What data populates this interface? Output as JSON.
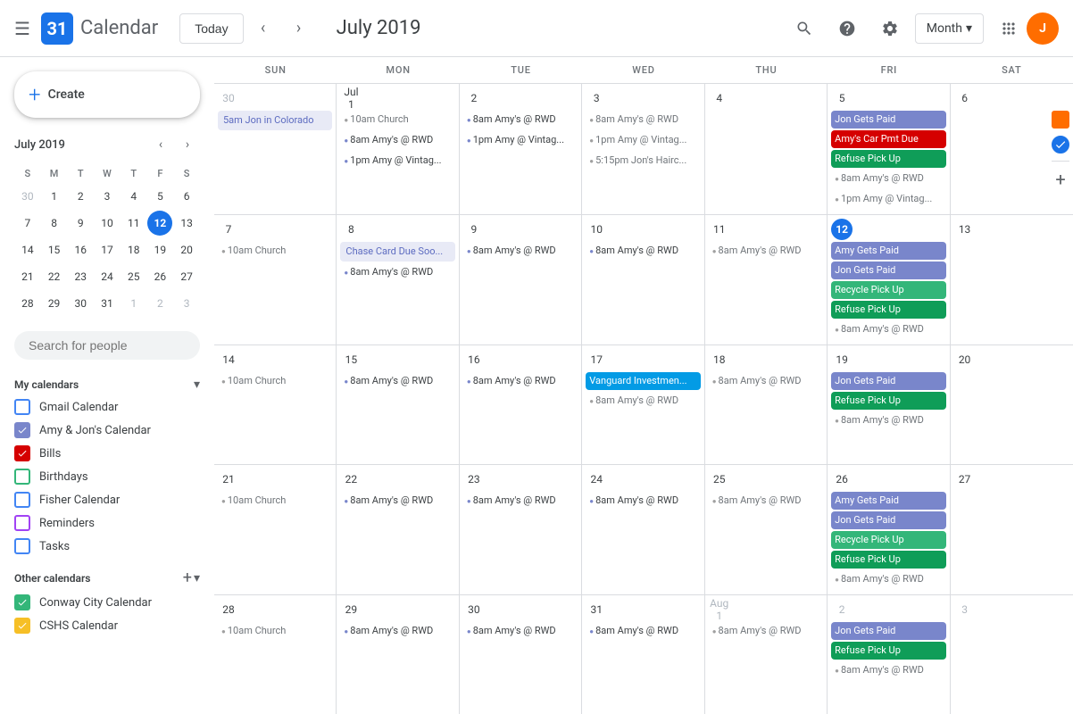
{
  "topbar": {
    "menu_label": "☰",
    "logo_num": "31",
    "app_name": "Calendar",
    "today_label": "Today",
    "nav_prev": "‹",
    "nav_next": "›",
    "title": "July 2019",
    "search_icon": "🔍",
    "help_icon": "?",
    "settings_icon": "⚙",
    "view_label": "Month",
    "apps_icon": "⋮⋮⋮",
    "avatar_initials": "J"
  },
  "sidebar": {
    "create_label": "Create",
    "mini_cal": {
      "title": "July 2019",
      "dows": [
        "S",
        "M",
        "T",
        "W",
        "T",
        "F",
        "S"
      ],
      "weeks": [
        [
          {
            "d": "30",
            "other": true
          },
          {
            "d": "1"
          },
          {
            "d": "2"
          },
          {
            "d": "3"
          },
          {
            "d": "4"
          },
          {
            "d": "5"
          },
          {
            "d": "6"
          }
        ],
        [
          {
            "d": "7"
          },
          {
            "d": "8"
          },
          {
            "d": "9"
          },
          {
            "d": "10"
          },
          {
            "d": "11"
          },
          {
            "d": "12",
            "today": true
          },
          {
            "d": "13"
          }
        ],
        [
          {
            "d": "14"
          },
          {
            "d": "15"
          },
          {
            "d": "16"
          },
          {
            "d": "17"
          },
          {
            "d": "18"
          },
          {
            "d": "19"
          },
          {
            "d": "20"
          }
        ],
        [
          {
            "d": "21"
          },
          {
            "d": "22"
          },
          {
            "d": "23"
          },
          {
            "d": "24"
          },
          {
            "d": "25"
          },
          {
            "d": "26"
          },
          {
            "d": "27"
          }
        ],
        [
          {
            "d": "28"
          },
          {
            "d": "29"
          },
          {
            "d": "30"
          },
          {
            "d": "31"
          },
          {
            "d": "1",
            "other": true
          },
          {
            "d": "2",
            "other": true
          },
          {
            "d": "3",
            "other": true
          }
        ]
      ]
    },
    "search_people_placeholder": "Search for people",
    "my_calendars": {
      "title": "My calendars",
      "items": [
        {
          "label": "Gmail Calendar",
          "color": "#4285f4",
          "checked": false
        },
        {
          "label": "Amy & Jon's Calendar",
          "color": "#7986cb",
          "checked": true
        },
        {
          "label": "Bills",
          "color": "#d50000",
          "checked": true
        },
        {
          "label": "Birthdays",
          "color": "#33b679",
          "checked": false
        },
        {
          "label": "Fisher Calendar",
          "color": "#4285f4",
          "checked": false
        },
        {
          "label": "Reminders",
          "color": "#a142f4",
          "checked": false
        },
        {
          "label": "Tasks",
          "color": "#4285f4",
          "checked": false
        }
      ]
    },
    "other_calendars": {
      "title": "Other calendars",
      "items": [
        {
          "label": "Conway City Calendar",
          "color": "#33b679",
          "checked": true
        },
        {
          "label": "CSHS Calendar",
          "color": "#f6bf26",
          "checked": true
        }
      ]
    }
  },
  "calendar": {
    "days_of_week": [
      "SUN",
      "MON",
      "TUE",
      "WED",
      "THU",
      "FRI",
      "SAT"
    ],
    "weeks": [
      {
        "days": [
          {
            "num": "30",
            "other": true,
            "events": [
              {
                "text": "5am Jon in Colorado",
                "style": "multi-day"
              }
            ]
          },
          {
            "num": "Jul 1",
            "events": [
              {
                "text": "10am Church",
                "style": "gray-dot"
              },
              {
                "text": "8am Amy's @ RWD",
                "style": "purple-dot"
              },
              {
                "text": "1pm Amy @ Vintag...",
                "style": "purple-dot"
              }
            ]
          },
          {
            "num": "2",
            "events": [
              {
                "text": "8am Amy's @ RWD",
                "style": "purple-dot"
              },
              {
                "text": "1pm Amy @ Vintag...",
                "style": "purple-dot"
              }
            ]
          },
          {
            "num": "3",
            "events": [
              {
                "text": "8am Amy's @ RWD",
                "style": "gray-dot"
              },
              {
                "text": "1pm Amy @ Vintag...",
                "style": "gray-dot"
              },
              {
                "text": "5:15pm Jon's Hairc...",
                "style": "gray-dot"
              }
            ]
          },
          {
            "num": "4",
            "events": []
          },
          {
            "num": "5",
            "events": [
              {
                "text": "Jon Gets Paid",
                "style": "purple"
              },
              {
                "text": "Amy's Car Pmt Due",
                "style": "red"
              },
              {
                "text": "Refuse Pick Up",
                "style": "green-light"
              },
              {
                "text": "8am Amy's @ RWD",
                "style": "gray-dot"
              },
              {
                "text": "1pm Amy @ Vintag...",
                "style": "gray-dot"
              }
            ]
          },
          {
            "num": "6",
            "events": []
          }
        ]
      },
      {
        "days": [
          {
            "num": "7",
            "events": [
              {
                "text": "10am Church",
                "style": "gray-dot"
              }
            ]
          },
          {
            "num": "8",
            "events": [
              {
                "text": "Chase Card Due Soo...",
                "style": "multi-day"
              },
              {
                "text": "8am Amy's @ RWD",
                "style": "purple-dot"
              }
            ]
          },
          {
            "num": "9",
            "events": [
              {
                "text": "8am Amy's @ RWD",
                "style": "purple-dot"
              }
            ]
          },
          {
            "num": "10",
            "events": [
              {
                "text": "8am Amy's @ RWD",
                "style": "purple-dot"
              }
            ]
          },
          {
            "num": "11",
            "events": [
              {
                "text": "8am Amy's @ RWD",
                "style": "gray-dot"
              }
            ]
          },
          {
            "num": "12",
            "today": true,
            "events": [
              {
                "text": "Amy Gets Paid",
                "style": "purple"
              },
              {
                "text": "Jon Gets Paid",
                "style": "purple"
              },
              {
                "text": "Recycle Pick Up",
                "style": "green-dark"
              },
              {
                "text": "Refuse Pick Up",
                "style": "green-light"
              },
              {
                "text": "8am Amy's @ RWD",
                "style": "gray-dot"
              }
            ]
          },
          {
            "num": "13",
            "events": []
          }
        ]
      },
      {
        "days": [
          {
            "num": "14",
            "events": [
              {
                "text": "10am Church",
                "style": "gray-dot"
              }
            ]
          },
          {
            "num": "15",
            "events": [
              {
                "text": "8am Amy's @ RWD",
                "style": "purple-dot"
              }
            ]
          },
          {
            "num": "16",
            "events": [
              {
                "text": "8am Amy's @ RWD",
                "style": "purple-dot"
              }
            ]
          },
          {
            "num": "17",
            "events": [
              {
                "text": "Vanguard Investmen...",
                "style": "teal"
              },
              {
                "text": "8am Amy's @ RWD",
                "style": "gray-dot"
              }
            ]
          },
          {
            "num": "18",
            "events": [
              {
                "text": "8am Amy's @ RWD",
                "style": "gray-dot"
              }
            ]
          },
          {
            "num": "19",
            "events": [
              {
                "text": "Jon Gets Paid",
                "style": "purple"
              },
              {
                "text": "Refuse Pick Up",
                "style": "green-light"
              },
              {
                "text": "8am Amy's @ RWD",
                "style": "gray-dot"
              }
            ]
          },
          {
            "num": "20",
            "events": []
          }
        ]
      },
      {
        "days": [
          {
            "num": "21",
            "events": [
              {
                "text": "10am Church",
                "style": "gray-dot"
              }
            ]
          },
          {
            "num": "22",
            "events": [
              {
                "text": "8am Amy's @ RWD",
                "style": "purple-dot"
              }
            ]
          },
          {
            "num": "23",
            "events": [
              {
                "text": "8am Amy's @ RWD",
                "style": "purple-dot"
              }
            ]
          },
          {
            "num": "24",
            "events": [
              {
                "text": "8am Amy's @ RWD",
                "style": "purple-dot"
              }
            ]
          },
          {
            "num": "25",
            "events": [
              {
                "text": "8am Amy's @ RWD",
                "style": "gray-dot"
              }
            ]
          },
          {
            "num": "26",
            "events": [
              {
                "text": "Amy Gets Paid",
                "style": "purple"
              },
              {
                "text": "Jon Gets Paid",
                "style": "purple"
              },
              {
                "text": "Recycle Pick Up",
                "style": "green-dark"
              },
              {
                "text": "Refuse Pick Up",
                "style": "green-light"
              },
              {
                "text": "8am Amy's @ RWD",
                "style": "gray-dot"
              }
            ]
          },
          {
            "num": "27",
            "events": []
          }
        ]
      },
      {
        "days": [
          {
            "num": "28",
            "events": [
              {
                "text": "10am Church",
                "style": "gray-dot"
              }
            ]
          },
          {
            "num": "29",
            "events": [
              {
                "text": "8am Amy's @ RWD",
                "style": "purple-dot"
              }
            ]
          },
          {
            "num": "30",
            "events": [
              {
                "text": "8am Amy's @ RWD",
                "style": "purple-dot"
              }
            ]
          },
          {
            "num": "31",
            "events": [
              {
                "text": "8am Amy's @ RWD",
                "style": "purple-dot"
              }
            ]
          },
          {
            "num": "Aug 1",
            "other": true,
            "events": [
              {
                "text": "8am Amy's @ RWD",
                "style": "gray-dot"
              }
            ]
          },
          {
            "num": "2",
            "other": true,
            "events": [
              {
                "text": "Jon Gets Paid",
                "style": "purple"
              },
              {
                "text": "Refuse Pick Up",
                "style": "green-light"
              },
              {
                "text": "8am Amy's @ RWD",
                "style": "gray-dot"
              }
            ]
          },
          {
            "num": "3",
            "other": true,
            "events": []
          }
        ]
      }
    ]
  }
}
